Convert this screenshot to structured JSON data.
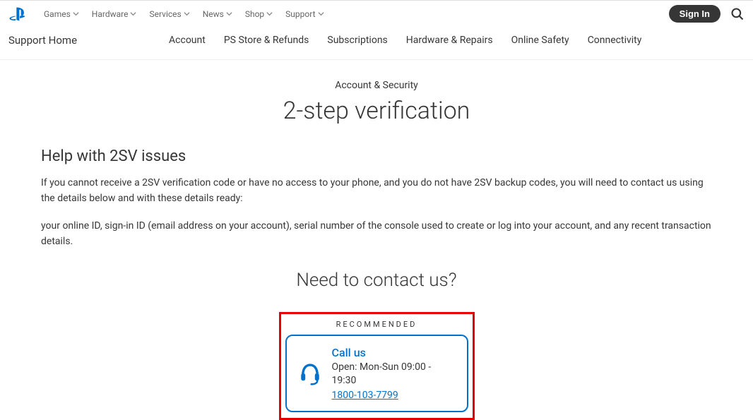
{
  "topNav": {
    "items": [
      "Games",
      "Hardware",
      "Services",
      "News",
      "Shop",
      "Support"
    ],
    "signIn": "Sign In"
  },
  "subNav": {
    "home": "Support Home",
    "items": [
      "Account",
      "PS Store & Refunds",
      "Subscriptions",
      "Hardware & Repairs",
      "Online Safety",
      "Connectivity"
    ]
  },
  "breadcrumb": "Account & Security",
  "title": "2-step verification",
  "section": {
    "heading": "Help with 2SV issues",
    "p1": "If you cannot receive a 2SV verification code or have no access to your phone, and you do not have 2SV backup codes, you will need to contact us using the details below and with these details ready:",
    "p2": "your online ID, sign-in ID (email address on your account), serial number of the console used to create or log into your account, and any recent transaction details."
  },
  "contact": {
    "title": "Need to contact us?",
    "recommended": "RECOMMENDED",
    "callUs": "Call us",
    "hours": "Open: Mon-Sun 09:00 - 19:30",
    "phone": "1800-103-7799"
  }
}
